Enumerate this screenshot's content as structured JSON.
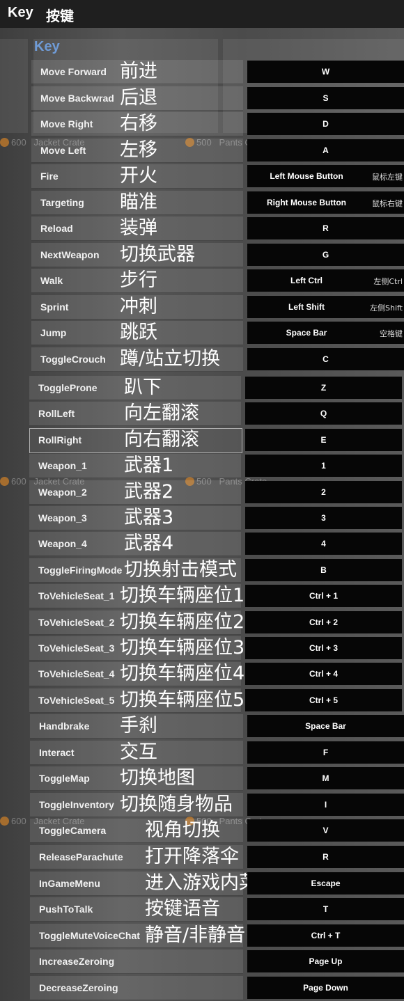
{
  "header": {
    "title_en": "Key",
    "title_cn": "按键"
  },
  "section_title": "Key",
  "background_loot": [
    {
      "price": "600",
      "name": "Jacket Crate"
    },
    {
      "price": "500",
      "name": "Pants Crate"
    }
  ],
  "colors": {
    "accent": "#6f9bd6",
    "key_bg": "#060606",
    "header_bg": "#1f1f1f"
  },
  "rows": [
    {
      "name": "Move Forward",
      "cn": "前进",
      "key": "W"
    },
    {
      "name": "Move Backwrad",
      "cn": "后退",
      "key": "S"
    },
    {
      "name": "Move Right",
      "cn": "右移",
      "key": "D"
    },
    {
      "name": "Move Left",
      "cn": "左移",
      "key": "A"
    },
    {
      "name": "Fire",
      "cn": "开火",
      "key": "Left Mouse Button",
      "key_cn": "鼠标左键"
    },
    {
      "name": "Targeting",
      "cn": "瞄准",
      "key": "Right Mouse Button",
      "key_cn": "鼠标右键"
    },
    {
      "name": "Reload",
      "cn": "装弹",
      "key": "R"
    },
    {
      "name": "NextWeapon",
      "cn": "切换武器",
      "key": "G"
    },
    {
      "name": "Walk",
      "cn": "步行",
      "key": "Left Ctrl",
      "key_cn": "左侧Ctrl"
    },
    {
      "name": "Sprint",
      "cn": "冲刺",
      "key": "Left Shift",
      "key_cn": "左侧Shift"
    },
    {
      "name": "Jump",
      "cn": "跳跃",
      "key": "Space Bar",
      "key_cn": "空格键"
    },
    {
      "name": "ToggleCrouch",
      "cn": "蹲/站立切换",
      "key": "C"
    },
    {
      "name": "ToggleProne",
      "cn": "趴下",
      "key": "Z"
    },
    {
      "name": "RollLeft",
      "cn": "向左翻滚",
      "key": "Q"
    },
    {
      "name": "RollRight",
      "cn": "向右翻滚",
      "key": "E",
      "selected": true
    },
    {
      "name": "Weapon_1",
      "cn": "武器1",
      "key": "1"
    },
    {
      "name": "Weapon_2",
      "cn": "武器2",
      "key": "2"
    },
    {
      "name": "Weapon_3",
      "cn": "武器3",
      "key": "3"
    },
    {
      "name": "Weapon_4",
      "cn": "武器4",
      "key": "4"
    },
    {
      "name": "ToggleFiringMode",
      "cn": "切换射击模式",
      "key": "B"
    },
    {
      "name": "ToVehicleSeat_1",
      "cn": "切换车辆座位1",
      "key": "Ctrl + 1"
    },
    {
      "name": "ToVehicleSeat_2",
      "cn": "切换车辆座位2",
      "key": "Ctrl + 2"
    },
    {
      "name": "ToVehicleSeat_3",
      "cn": "切换车辆座位3",
      "key": "Ctrl + 3"
    },
    {
      "name": "ToVehicleSeat_4",
      "cn": "切换车辆座位4",
      "key": "Ctrl + 4"
    },
    {
      "name": "ToVehicleSeat_5",
      "cn": "切换车辆座位5",
      "key": "Ctrl + 5"
    },
    {
      "name": "Handbrake",
      "cn": "手刹",
      "key": "Space Bar"
    },
    {
      "name": "Interact",
      "cn": "交互",
      "key": "F"
    },
    {
      "name": "ToggleMap",
      "cn": "切换地图",
      "key": "M"
    },
    {
      "name": "ToggleInventory",
      "cn": "切换随身物品",
      "key": "I"
    },
    {
      "name": "ToggleCamera",
      "cn": "视角切换",
      "key": "V"
    },
    {
      "name": "ReleaseParachute",
      "cn": "打开降落伞",
      "key": "R"
    },
    {
      "name": "InGameMenu",
      "cn": "进入游戏内菜单",
      "key": "Escape"
    },
    {
      "name": "PushToTalk",
      "cn": "按键语音",
      "key": "T"
    },
    {
      "name": "ToggleMuteVoiceChat",
      "cn": "静音/非静音 切换",
      "key": "Ctrl + T"
    },
    {
      "name": "IncreaseZeroing",
      "cn": "",
      "key": "Page Up"
    },
    {
      "name": "DecreaseZeroing",
      "cn": "",
      "key": "Page Down"
    }
  ]
}
